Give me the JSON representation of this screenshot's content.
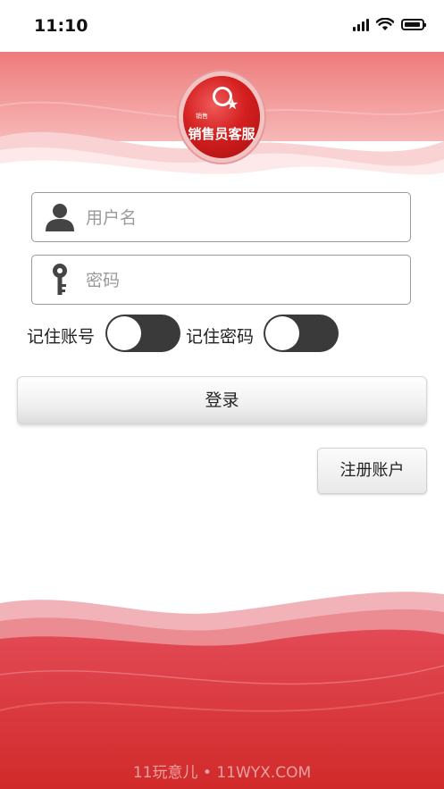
{
  "status_bar": {
    "time": "11:10"
  },
  "logo": {
    "text": "销售员客服",
    "mini_text": "销售"
  },
  "form": {
    "username": {
      "placeholder": "用户名",
      "value": ""
    },
    "password": {
      "placeholder": "密码",
      "value": ""
    },
    "remember_account_label": "记住账号",
    "remember_password_label": "记住密码",
    "remember_account_on": false,
    "remember_password_on": false
  },
  "buttons": {
    "login": "登录",
    "register": "注册账户"
  },
  "watermark": "11玩意儿 • 11WYX.COM",
  "colors": {
    "brand_red": "#d41f1f",
    "toggle_track": "#3a3a3a"
  }
}
